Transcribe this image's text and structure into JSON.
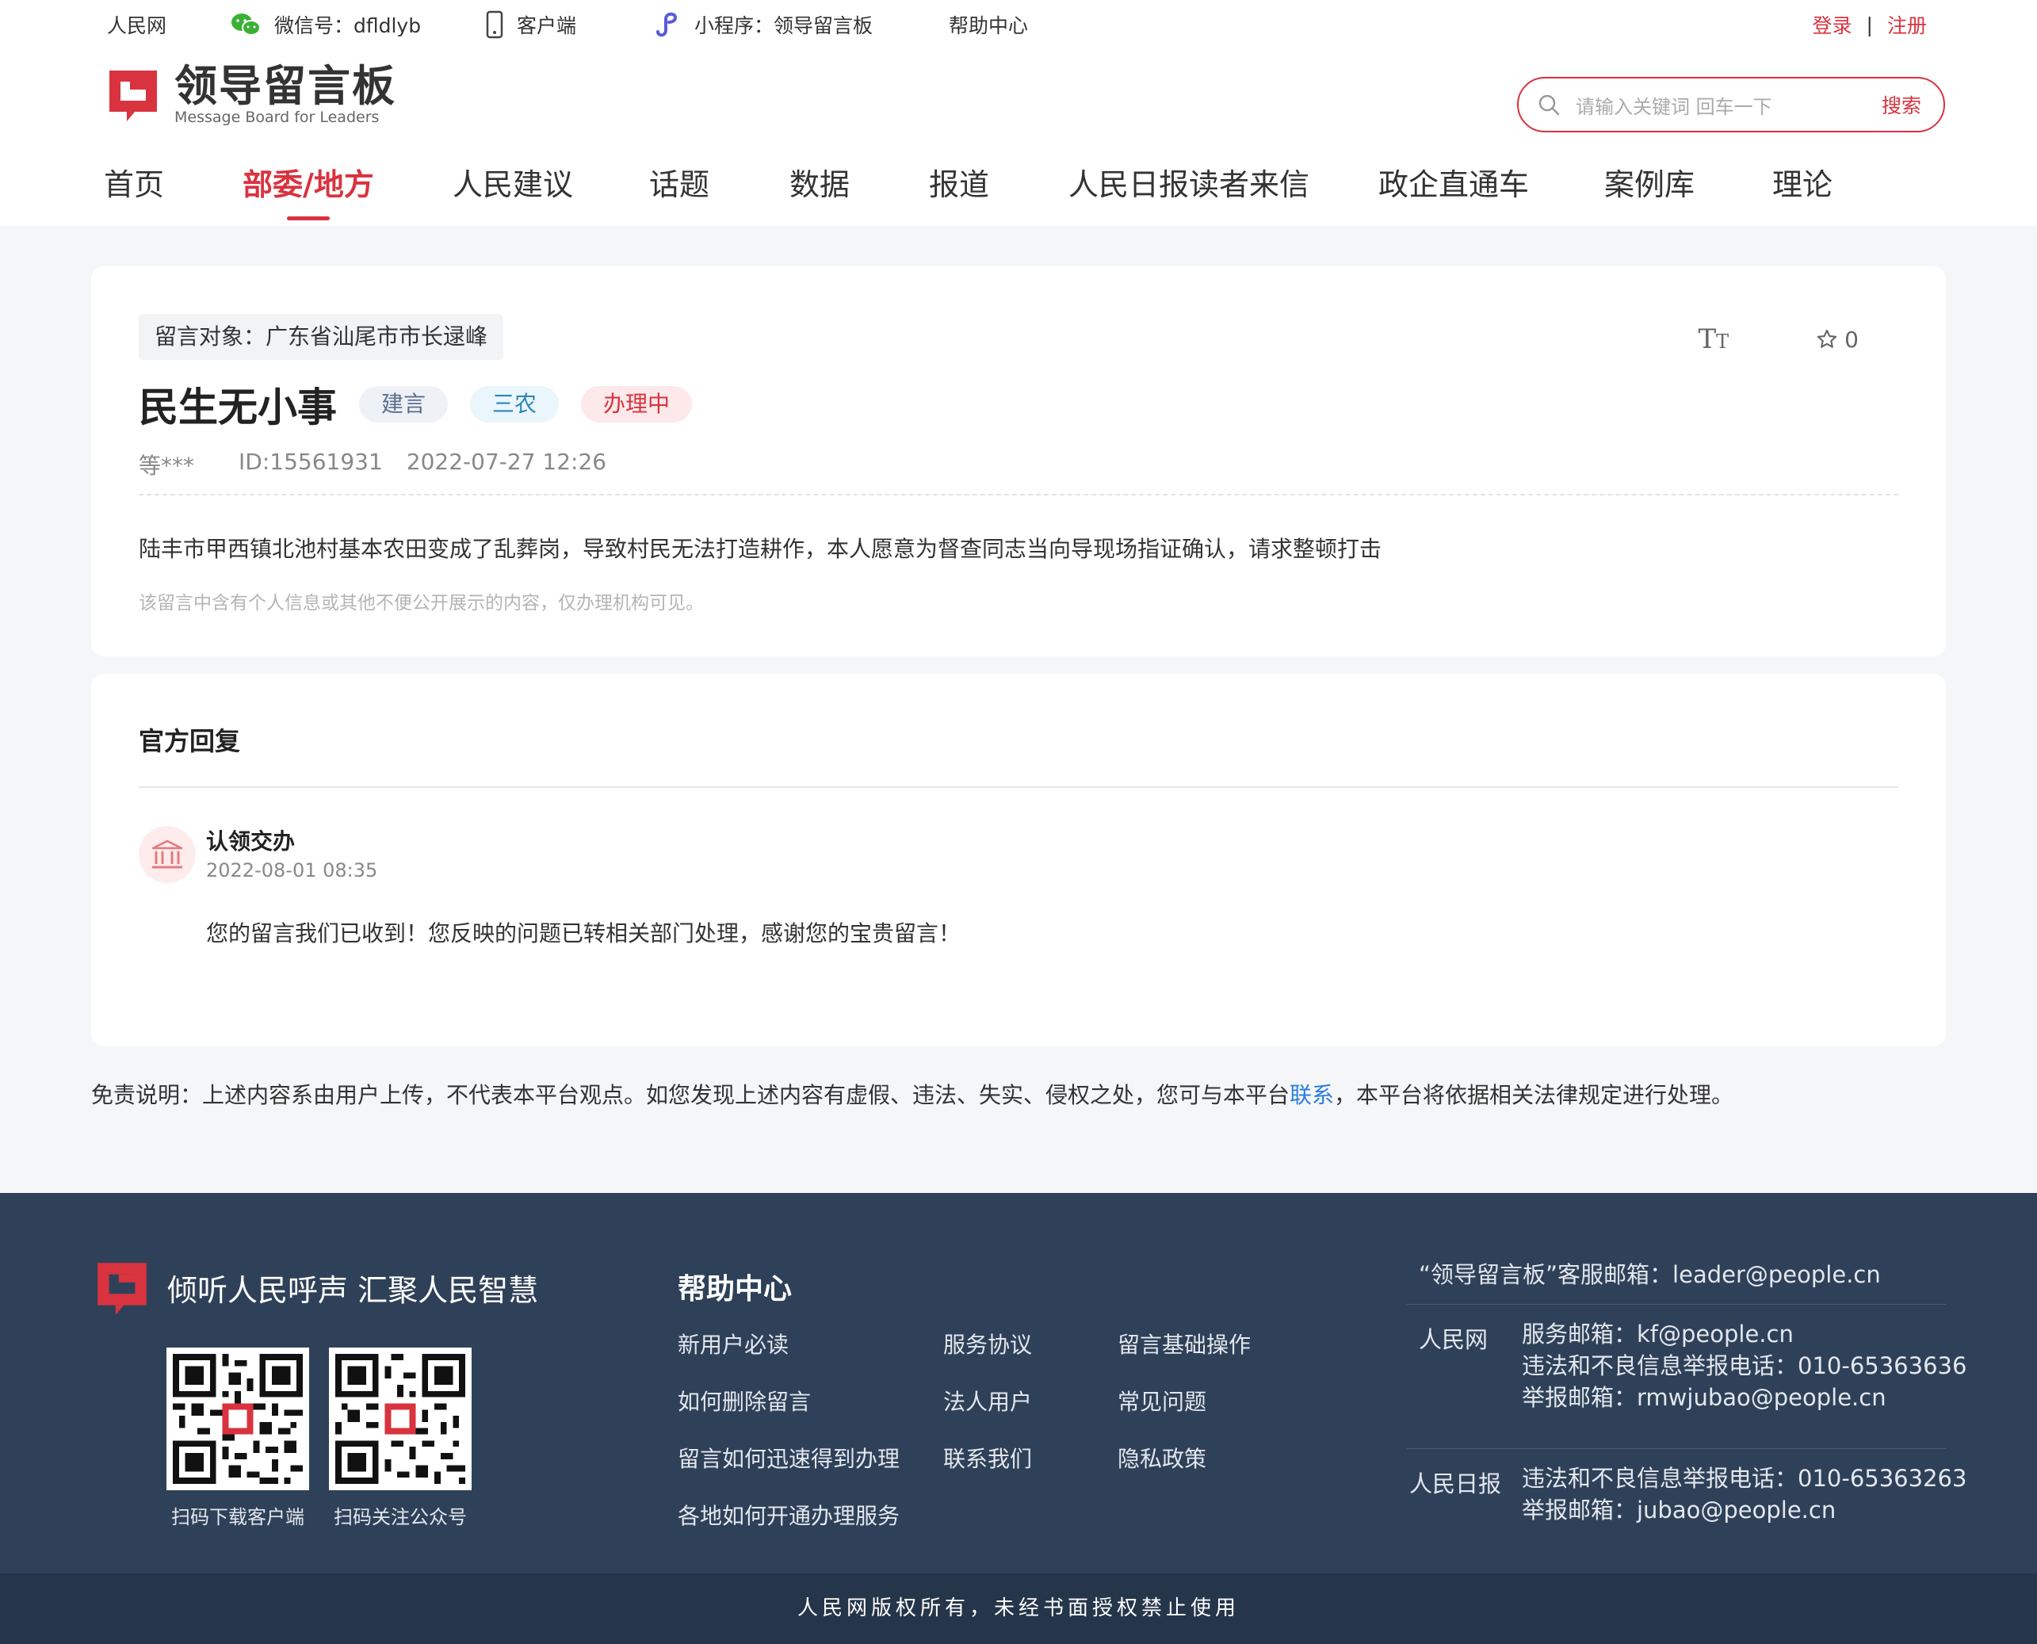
{
  "topbar": {
    "site": "人民网",
    "wechat": "微信号：dfldlyb",
    "client": "客户端",
    "miniprogram": "小程序：领导留言板",
    "help": "帮助中心",
    "login": "登录",
    "separator": "|",
    "register": "注册"
  },
  "logo": {
    "cn": "领导留言板",
    "en": "Message Board for Leaders"
  },
  "search": {
    "placeholder": "请输入关键词 回车一下",
    "button": "搜索"
  },
  "nav": [
    "首页",
    "部委/地方",
    "人民建议",
    "话题",
    "数据",
    "报道",
    "人民日报读者来信",
    "政企直通车",
    "案例库",
    "理论"
  ],
  "nav_active": "部委/地方",
  "message": {
    "target": "留言对象：广东省汕尾市市长逯峰",
    "font_tool": "TT",
    "favorites": "0",
    "title": "民生无小事",
    "tags": [
      "建言",
      "三农",
      "办理中"
    ],
    "author": "等***",
    "id": "ID:15561931",
    "time": "2022-07-27 12:26",
    "content": "陆丰市甲西镇北池村基本农田变成了乱葬岗，导致村民无法打造耕作，本人愿意为督查同志当向导现场指证确认，请求整顿打击",
    "note": "该留言中含有个人信息或其他不便公开展示的内容，仅办理机构可见。"
  },
  "reply": {
    "heading": "官方回复",
    "name": "认领交办",
    "time": "2022-08-01 08:35",
    "body": "您的留言我们已收到！您反映的问题已转相关部门处理，感谢您的宝贵留言！"
  },
  "disclaimer": {
    "before": "免责说明：上述内容系由用户上传，不代表本平台观点。如您发现上述内容有虚假、违法、失实、侵权之处，您可与本平台",
    "link": "联系",
    "after": "，本平台将依据相关法律规定进行处理。"
  },
  "footer": {
    "slogan": "倾听人民呼声 汇聚人民智慧",
    "qr1_caption": "扫码下载客户端",
    "qr2_caption": "扫码关注公众号",
    "help_heading": "帮助中心",
    "help_links": {
      "col1": [
        "新用户必读",
        "如何删除留言",
        "留言如何迅速得到办理",
        "各地如何开通办理服务"
      ],
      "col2": [
        "服务协议",
        "法人用户",
        "联系我们"
      ],
      "col3": [
        "留言基础操作",
        "常见问题",
        "隐私政策"
      ]
    },
    "service_email": "“领导留言板”客服邮箱：leader@people.cn",
    "people_net_label": "人民网",
    "people_net_lines": [
      "服务邮箱：kf@people.cn",
      "违法和不良信息举报电话：010-65363636",
      "举报邮箱：rmwjubao@people.cn"
    ],
    "people_daily_label": "人民日报",
    "people_daily_lines": [
      "违法和不良信息举报电话：010-65363263",
      "举报邮箱：jubao@people.cn"
    ],
    "copyright": "人民网版权所有，未经书面授权禁止使用"
  },
  "colors": {
    "accent": "#d9333f",
    "footer_bg": "#2f4158",
    "footer_bottom": "#25354a",
    "link": "#2b7de0"
  }
}
